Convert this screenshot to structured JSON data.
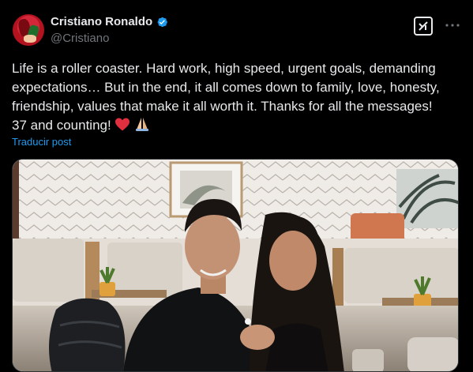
{
  "author": {
    "display_name": "Cristiano Ronaldo",
    "handle": "@Cristiano",
    "avatar_icon": "avatar-image",
    "verified_icon": "verified-badge-icon"
  },
  "tweet": {
    "text_line1": "Life is a roller coaster. Hard work, high speed, urgent goals, demanding",
    "text_line2": "expectations… But in the end, it all comes down to family, love, honesty,",
    "text_line3": "friendship, values that make it all worth it. Thanks for all the messages!",
    "text_line4": "37 and counting!",
    "translate_label": "Traducir post"
  },
  "colors": {
    "background": "#000000",
    "text": "#e7e9ea",
    "secondary": "#71767b",
    "accent": "#1d9bf0"
  },
  "icons": {
    "grok": "grok-icon",
    "more": "more-icon",
    "heart": "red-heart-emoji",
    "pray": "folded-hands-emoji"
  }
}
